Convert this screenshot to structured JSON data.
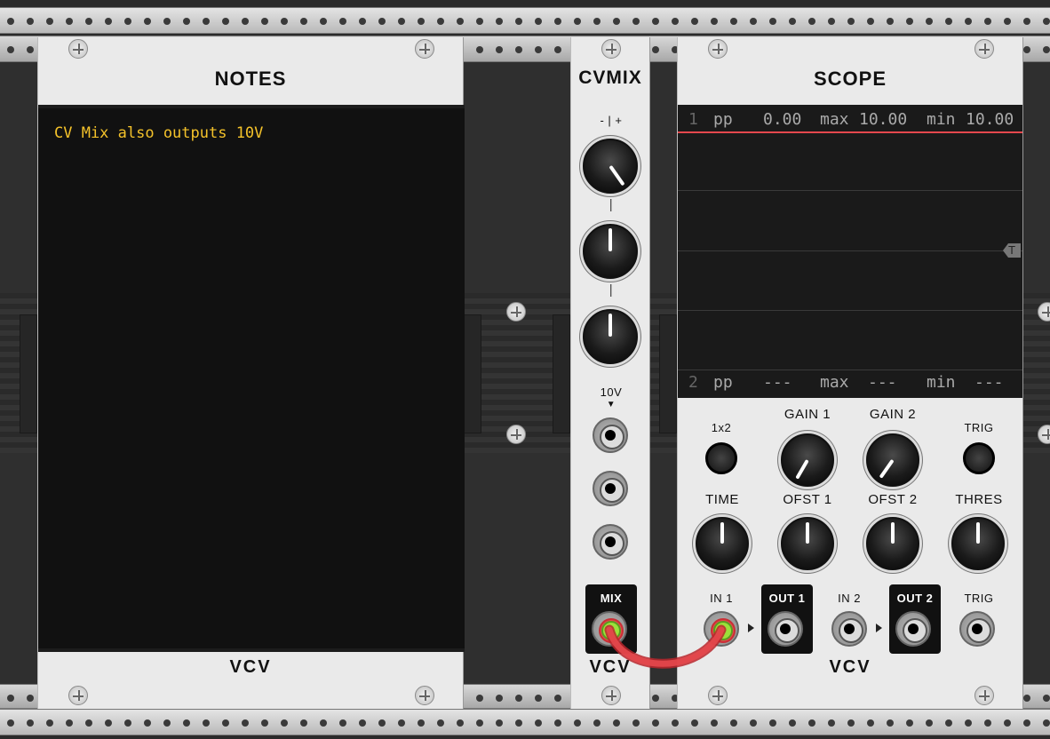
{
  "rack": {
    "screw_icon": "plus-screw-icon"
  },
  "notes_module": {
    "title": "NOTES",
    "text": "CV Mix also outputs 10V",
    "brand": "VCV"
  },
  "cvmix_module": {
    "title": "CVMIX",
    "range_label": "- | +",
    "knob_separator_1": "|",
    "knob_separator_2": "|",
    "voltage_label": "10V",
    "voltage_arrow": "▼",
    "mix_label": "MIX",
    "brand": "VCV"
  },
  "scope_module": {
    "title": "SCOPE",
    "channel1": {
      "index": "1",
      "pp_label": "pp",
      "pp": "0.00",
      "max_label": "max",
      "max": "10.00",
      "min_label": "min",
      "min": "10.00"
    },
    "channel2": {
      "index": "2",
      "pp_label": "pp",
      "pp": "---",
      "max_label": "max",
      "max": "---",
      "min_label": "min",
      "min": "---"
    },
    "trigger_marker": "T",
    "labels": {
      "mode_1x2": "1x2",
      "gain1": "GAIN 1",
      "gain2": "GAIN 2",
      "trig_button": "TRIG",
      "time": "TIME",
      "ofst1": "OFST 1",
      "ofst2": "OFST 2",
      "thres": "THRES",
      "in1": "IN 1",
      "out1": "OUT 1",
      "in2": "IN 2",
      "out2": "OUT 2",
      "trig_in": "TRIG"
    },
    "brand": "VCV"
  },
  "colors": {
    "note_text": "#f4c22a",
    "cable": "#e5484d",
    "plug_center": "#9be13a",
    "scope_trace": "#e5484d"
  }
}
